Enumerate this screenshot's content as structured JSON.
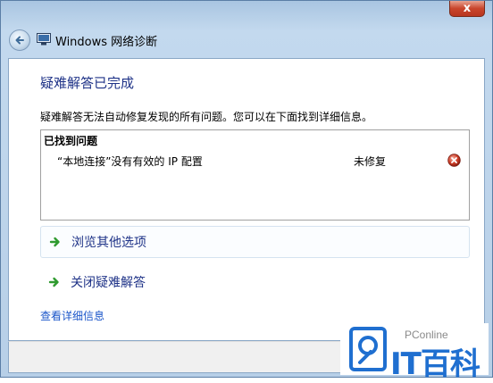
{
  "window": {
    "title": "Windows 网络诊断",
    "close_glyph": "x"
  },
  "page": {
    "heading": "疑难解答已完成",
    "description": "疑难解答无法自动修复发现的所有问题。您可以在下面找到详细信息。"
  },
  "problems": {
    "header": "已找到问题",
    "items": [
      {
        "name": "“本地连接”没有有效的 IP 配置",
        "status": "未修复",
        "status_icon": "error-icon"
      }
    ]
  },
  "options": [
    {
      "label": "浏览其他选项",
      "icon": "green-arrow-icon"
    },
    {
      "label": "关闭疑难解答",
      "icon": "green-arrow-icon"
    }
  ],
  "links": {
    "details": "查看详细信息"
  },
  "watermark": {
    "small": "PConline",
    "big": "IT百科"
  },
  "colors": {
    "heading": "#1e3287",
    "link": "#1a55c9",
    "arrow": "#2f9a2f",
    "error": "#c0392b",
    "watermark": "#1f6fd0"
  }
}
